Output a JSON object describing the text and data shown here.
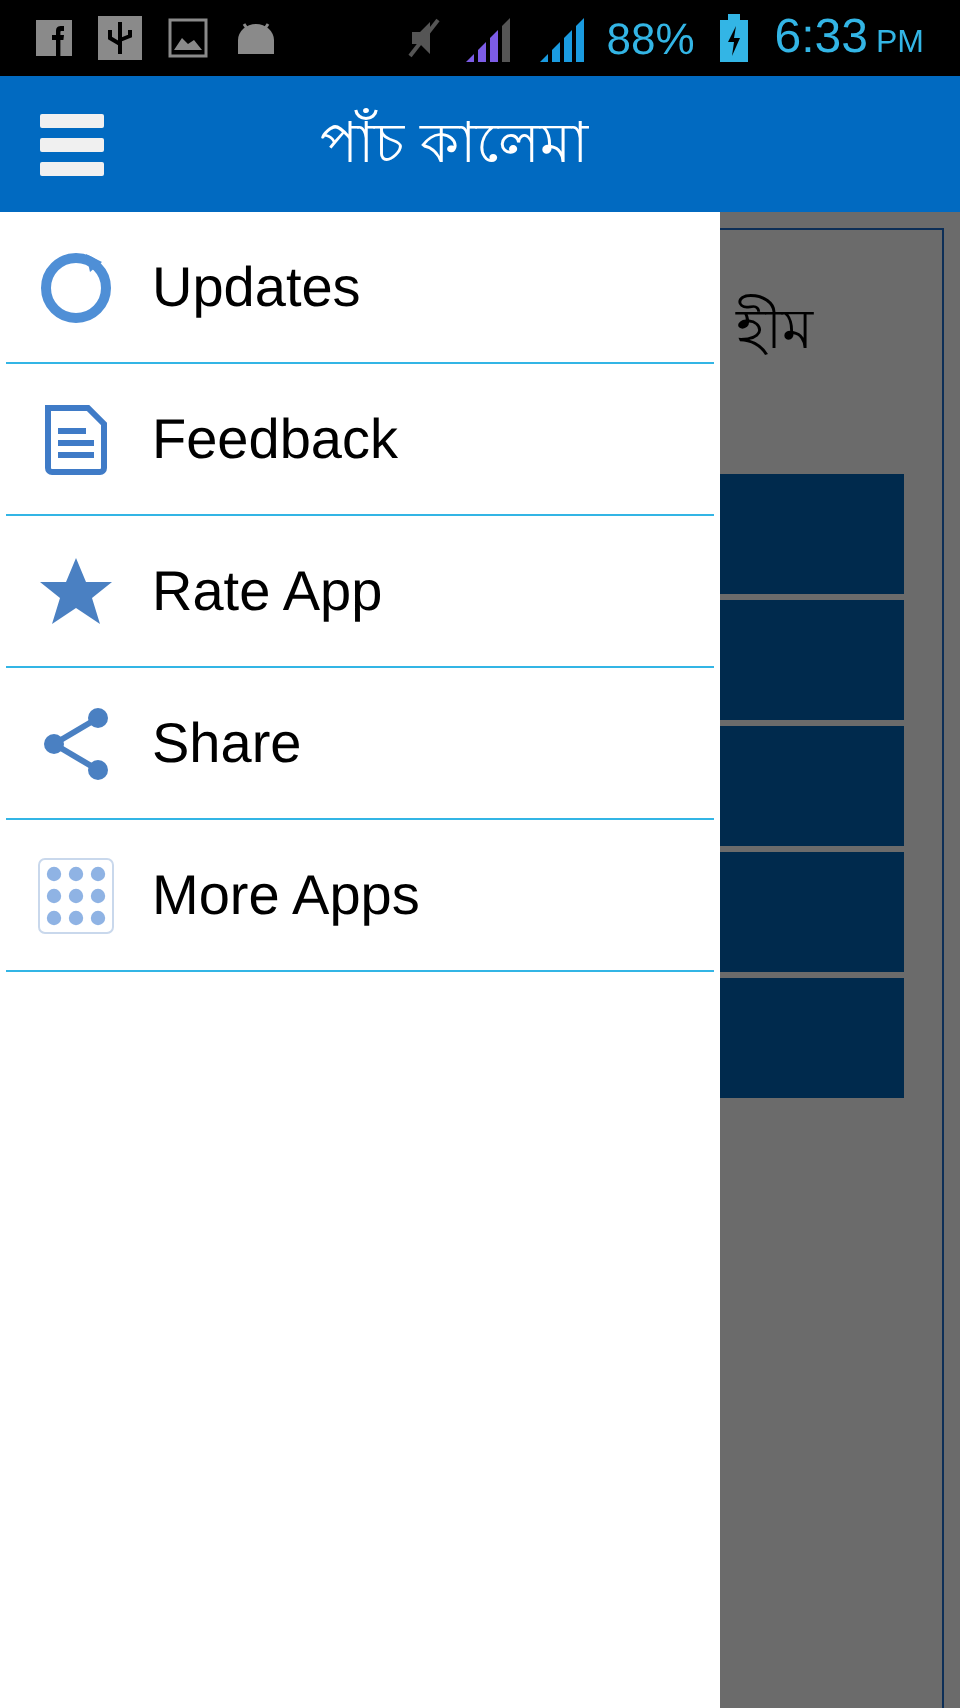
{
  "status_bar": {
    "battery": "88%",
    "time": "6:33",
    "ampm": "PM"
  },
  "app_bar": {
    "title": "পাঁচ কালেমা"
  },
  "drawer": {
    "items": [
      {
        "kind": "updates",
        "label": "Updates"
      },
      {
        "kind": "feedback",
        "label": "Feedback"
      },
      {
        "kind": "rate",
        "label": "Rate App"
      },
      {
        "kind": "share",
        "label": "Share"
      },
      {
        "kind": "more",
        "label": "More Apps"
      }
    ]
  },
  "background": {
    "heading": "হীম"
  }
}
